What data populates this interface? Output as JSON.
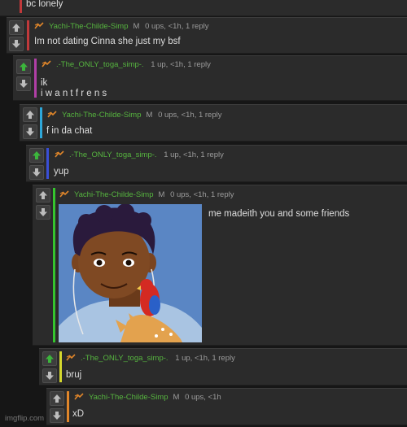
{
  "colors": {
    "bg": "#161616",
    "panel": "#2b2b2b",
    "username": "#56b53f",
    "upvote_active": "#3cb53c",
    "bar_red": "#c0393b",
    "bar_magenta": "#b13fa6",
    "bar_cyan": "#2ea7d9",
    "bar_blue": "#3a4fd6",
    "bar_green": "#35c52e",
    "bar_yellow": "#d5d82e",
    "bar_orange": "#e0862a"
  },
  "icons": [
    "upvote-arrow-icon",
    "downvote-arrow-icon",
    "imgflip-logo-icon"
  ],
  "comments": [
    {
      "body": "bc lonely"
    },
    {
      "user": "Yachi-The-Childe-Simp",
      "flag": "M",
      "stats": "0 ups, <1h, 1 reply",
      "body": "Im not dating Cinna she just my bsf"
    },
    {
      "user": ".-The_ONLY_toga_simp-.",
      "stats": "1 up, <1h, 1 reply",
      "body_line1": "ik",
      "body_line2": "i w a n t f r e n s"
    },
    {
      "user": "Yachi-The-Childe-Simp",
      "flag": "M",
      "stats": "0 ups, <1h, 1 reply",
      "body": "f in da chat"
    },
    {
      "user": ".-The_ONLY_toga_simp-.",
      "stats": "1 up, <1h, 1 reply",
      "body": "yup"
    },
    {
      "user": "Yachi-The-Childe-Simp",
      "flag": "M",
      "stats": "0 ups, <1h, 1 reply",
      "body": "me madeith you and some friends"
    },
    {
      "user": ".-The_ONLY_toga_simp-.",
      "stats": "1 up, <1h, 1 reply",
      "body": "bruj"
    },
    {
      "user": "Yachi-The-Childe-Simp",
      "flag": "M",
      "stats": "0 ups, <1h",
      "body": "xD"
    }
  ],
  "watermark": "imgflip.com"
}
